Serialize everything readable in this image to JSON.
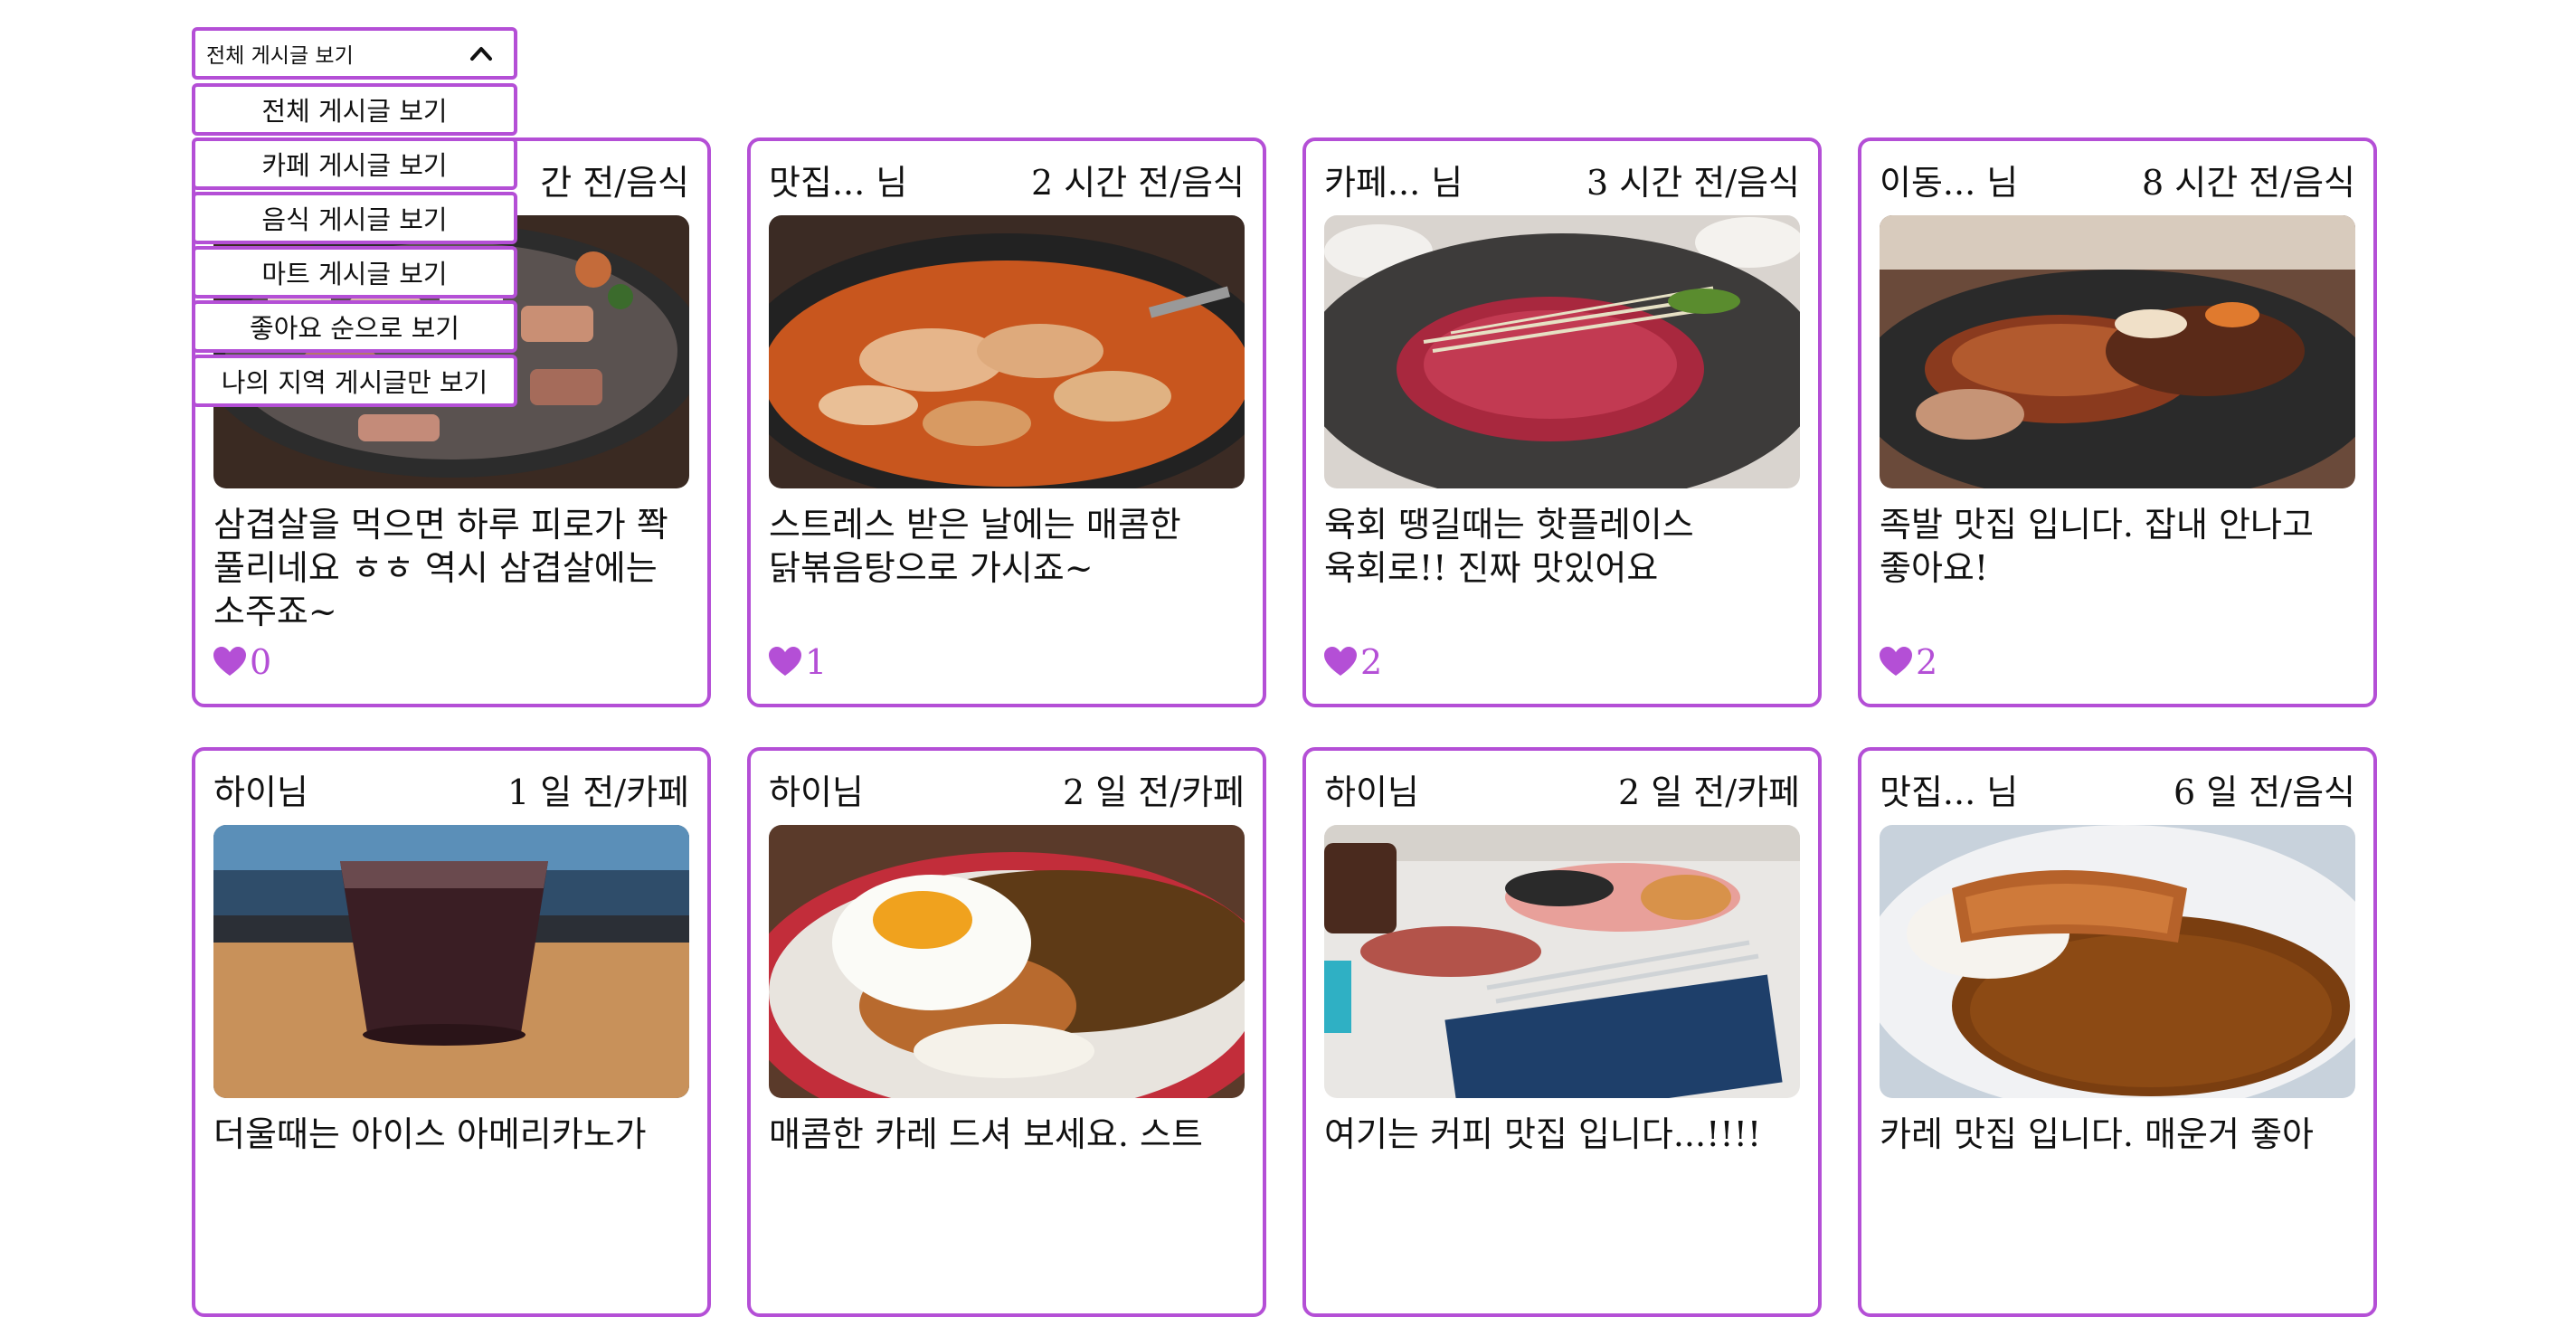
{
  "filter": {
    "selected": "전체 게시글 보기",
    "options": [
      "전체 게시글 보기",
      "카페 게시글 보기",
      "음식 게시글 보기",
      "마트 게시글 보기",
      "좋아요 순으로 보기",
      "나의 지역 게시글만 보기"
    ]
  },
  "accent_color": "#b44fd6",
  "posts": [
    {
      "author": "",
      "time": "간 전/음식",
      "photo": "삼겹살 구이",
      "text": "삼겹살을 먹으면 하루 피로가 쫙 풀리네요 ㅎㅎ 역시 삼겹살에는 소주죠~",
      "likes": "0"
    },
    {
      "author": "맛집... 님",
      "time": "2 시간 전/음식",
      "photo": "닭볶음탕",
      "text": "스트레스 받은 날에는 매콤한 닭볶음탕으로 가시죠~",
      "likes": "1"
    },
    {
      "author": "카페... 님",
      "time": "3 시간 전/음식",
      "photo": "육회",
      "text": "육회 땡길때는 핫플레이스 육회로!! 진짜 맛있어요",
      "likes": "2"
    },
    {
      "author": "이동... 님",
      "time": "8 시간 전/음식",
      "photo": "족발",
      "text": "족발 맛집 입니다. 잡내 안나고 좋아요!",
      "likes": "2"
    },
    {
      "author": "하이님",
      "time": "1 일 전/카페",
      "photo": "아이스 아메리카노",
      "text": "더울때는 아이스 아메리카노가",
      "likes": ""
    },
    {
      "author": "하이님",
      "time": "2 일 전/카페",
      "photo": "카레",
      "text": "매콤한 카레 드셔 보세요. 스트",
      "likes": ""
    },
    {
      "author": "하이님",
      "time": "2 일 전/카페",
      "photo": "커피와 디저트",
      "text": "여기는 커피 맛집 입니다...!!!!",
      "likes": ""
    },
    {
      "author": "맛집... 님",
      "time": "6 일 전/음식",
      "photo": "돈까스 카레",
      "text": "카레 맛집 입니다. 매운거 좋아",
      "likes": ""
    }
  ]
}
